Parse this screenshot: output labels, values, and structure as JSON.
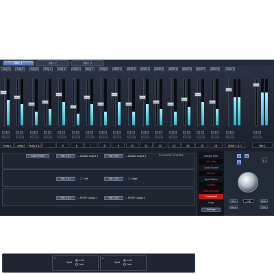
{
  "tabs": [
    {
      "label": "Mix 1",
      "active": true
    },
    {
      "label": "Mix 2",
      "active": false
    },
    {
      "label": "Mix 3",
      "active": false
    }
  ],
  "strips": [
    {
      "source": "Anlg 1",
      "label": "Anlg 1",
      "level": 0.55
    },
    {
      "source": "Anlg 2",
      "label": "Anlg 2",
      "level": 0.45
    },
    {
      "source": "Anlg 3",
      "label": "Anlg 3 & 4",
      "level": 0.3
    },
    {
      "source": "Anlg 4",
      "label": "",
      "level": 0.35
    },
    {
      "source": "Anlg 5",
      "label": "5",
      "level": 0.5
    },
    {
      "source": "Anlg 6",
      "label": "6",
      "level": 0.25
    },
    {
      "source": "Anlg 7",
      "label": "7",
      "level": 0.45
    },
    {
      "source": "Anlg 8",
      "label": "8",
      "level": 0.3
    },
    {
      "source": "ADAT 1",
      "label": "9",
      "level": 0.5
    },
    {
      "source": "ADAT 2",
      "label": "10",
      "level": 0.3
    },
    {
      "source": "ADAT 3",
      "label": "11",
      "level": 0.45
    },
    {
      "source": "ADAT 4",
      "label": "12",
      "level": 0.35
    },
    {
      "source": "ADAT 5",
      "label": "13",
      "level": 0.3
    },
    {
      "source": "ADAT 6",
      "label": "14",
      "level": 0.4
    },
    {
      "source": "ADAT 7",
      "label": "15",
      "level": 0.5
    },
    {
      "source": "ADAT 8",
      "label": "16",
      "level": 0.35
    }
  ],
  "daw_strip": {
    "source": "DAW 1",
    "label": "DAW 1 & 2",
    "level": 0.6
  },
  "master_strip": {
    "label": "Mix 1",
    "level": 0.7
  },
  "routing": {
    "load_preset": "Load Preset",
    "brand": "Focusrite Scarlett",
    "rows": [
      {
        "left_btn": "Mix 1 (L)",
        "left_label": "→ Monitor Output 1",
        "right_btn": "Mix 1 (R)",
        "right_label": "→ Monitor Output 2"
      },
      {
        "left_btn": "Mix 1 (L)",
        "left_label": "→ 🎧 Left",
        "right_btn": "Mix 1 (R)",
        "right_label": "→ 🎧 Right"
      },
      {
        "left_btn": "Mix 1 (L)",
        "left_label": "→ SPDIF Output 1",
        "right_btn": "Mix 1 (R)",
        "right_label": "→ SPDIF Output 2"
      }
    ],
    "input1_num": "1",
    "input2_num": "2",
    "input_label": "Input",
    "line_label": "Line",
    "inst_label": "Inst"
  },
  "status": {
    "sample_rate_label": "Sample Rate",
    "sample_rate_value": "44.1 kHz",
    "clock_label": "Clock Source",
    "clock_value": "Internal",
    "sync_label": "Sync Status",
    "sync_value": "Locked",
    "driver_label": "USB 2.0 Driver",
    "driver_value": "Connected",
    "links_label": "Links",
    "settings_button": "Settings"
  },
  "monitor": {
    "dim_label": "Dim",
    "mute_label": "Mute",
    "value_display": "0dB",
    "mono_label": "Mono",
    "solo_label": "Solo"
  }
}
